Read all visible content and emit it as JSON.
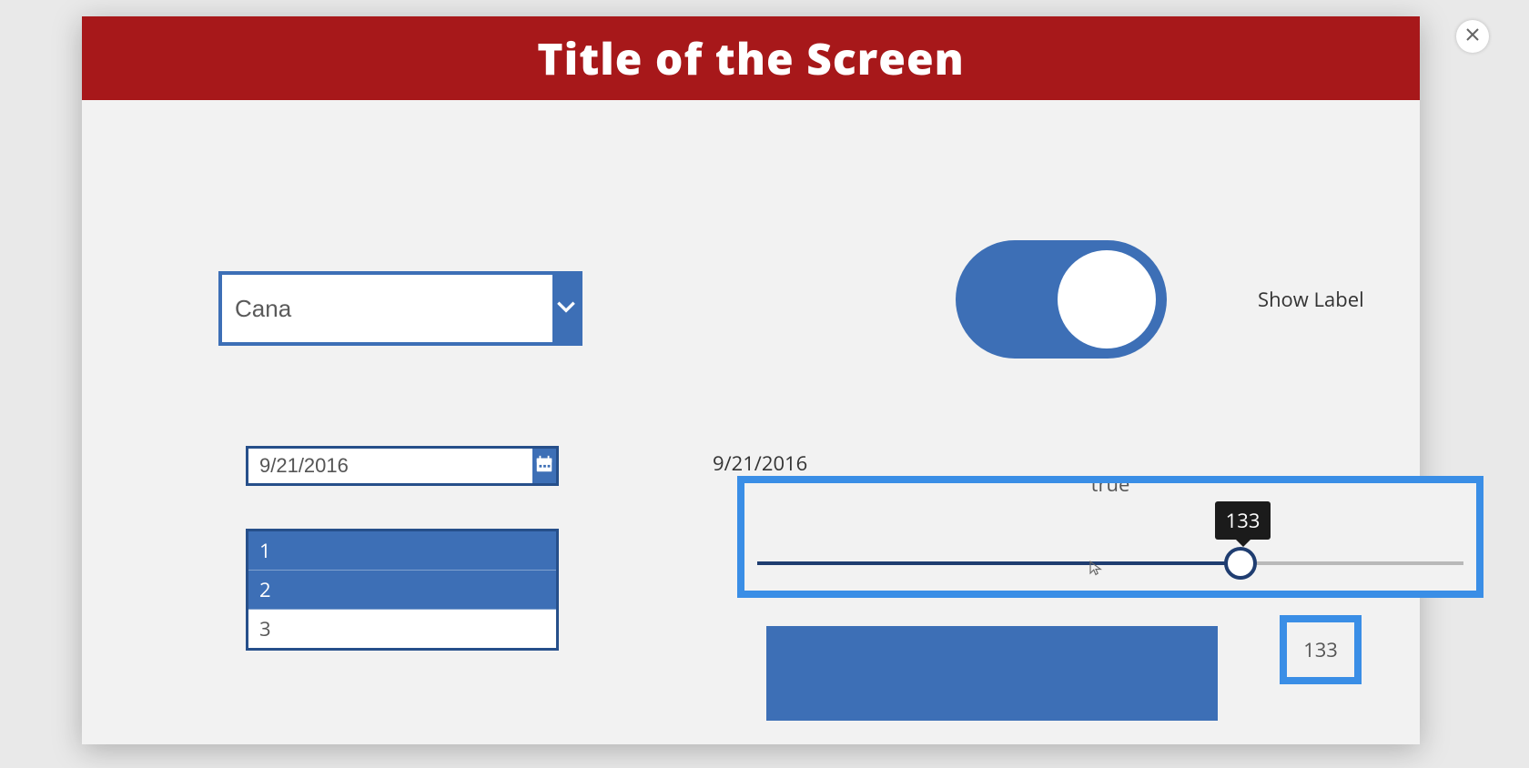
{
  "header": {
    "title": "Title of the Screen"
  },
  "combo": {
    "value": "Cana"
  },
  "toggle": {
    "on": true,
    "label": "Show Label"
  },
  "datepicker": {
    "value": "9/21/2016"
  },
  "date_text": "9/21/2016",
  "listbox": {
    "items": [
      "1",
      "2",
      "3"
    ],
    "selected_indices": [
      0,
      1
    ]
  },
  "slider": {
    "peek_text": "true",
    "value": 133,
    "tooltip": "133"
  },
  "value_box": "133"
}
